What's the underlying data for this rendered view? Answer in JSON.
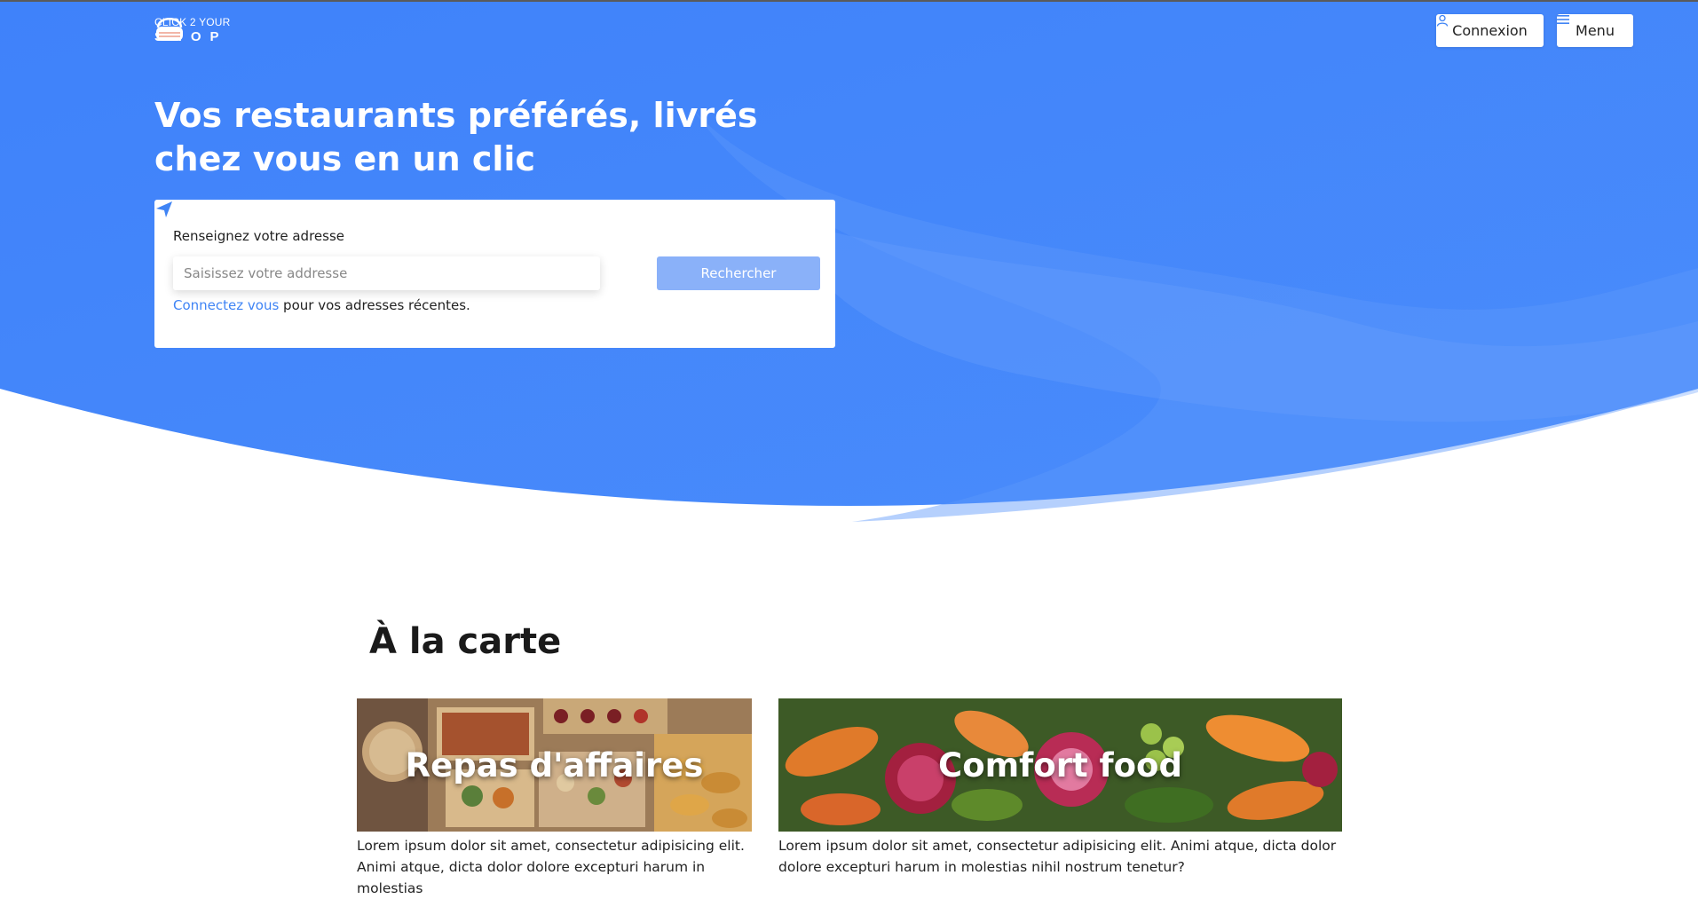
{
  "colors": {
    "hero_blue": "#4587fb",
    "accent": "#3f84f5",
    "search_button_bg": "#8ab1f9"
  },
  "header": {
    "logo_line1": "CLICK 2 YOUR",
    "logo_line2": "SHOP",
    "login_icon": "user-icon",
    "login_label": "Connexion",
    "menu_icon": "hamburger-icon",
    "menu_label": "Menu"
  },
  "hero": {
    "title": "Vos restaurants préférés, livrés chez vous en un clic"
  },
  "search": {
    "label": "Renseignez votre adresse",
    "placeholder": "Saisissez votre addresse",
    "value": "",
    "locate_icon": "location-arrow-icon",
    "button_label": "Rechercher",
    "recent_link": "Connectez vous",
    "recent_text": " pour vos adresses récentes."
  },
  "carte": {
    "title": "À la carte",
    "cards": [
      {
        "title": "Repas d'affaires",
        "text": "Lorem ipsum dolor sit amet, consectetur adipisicing elit. Animi atque, dicta dolor dolore excepturi harum in molestias"
      },
      {
        "title": "Comfort food",
        "text": "Lorem ipsum dolor sit amet, consectetur adipisicing elit. Animi atque, dicta dolor dolore excepturi harum in molestias nihil nostrum tenetur?"
      }
    ]
  }
}
